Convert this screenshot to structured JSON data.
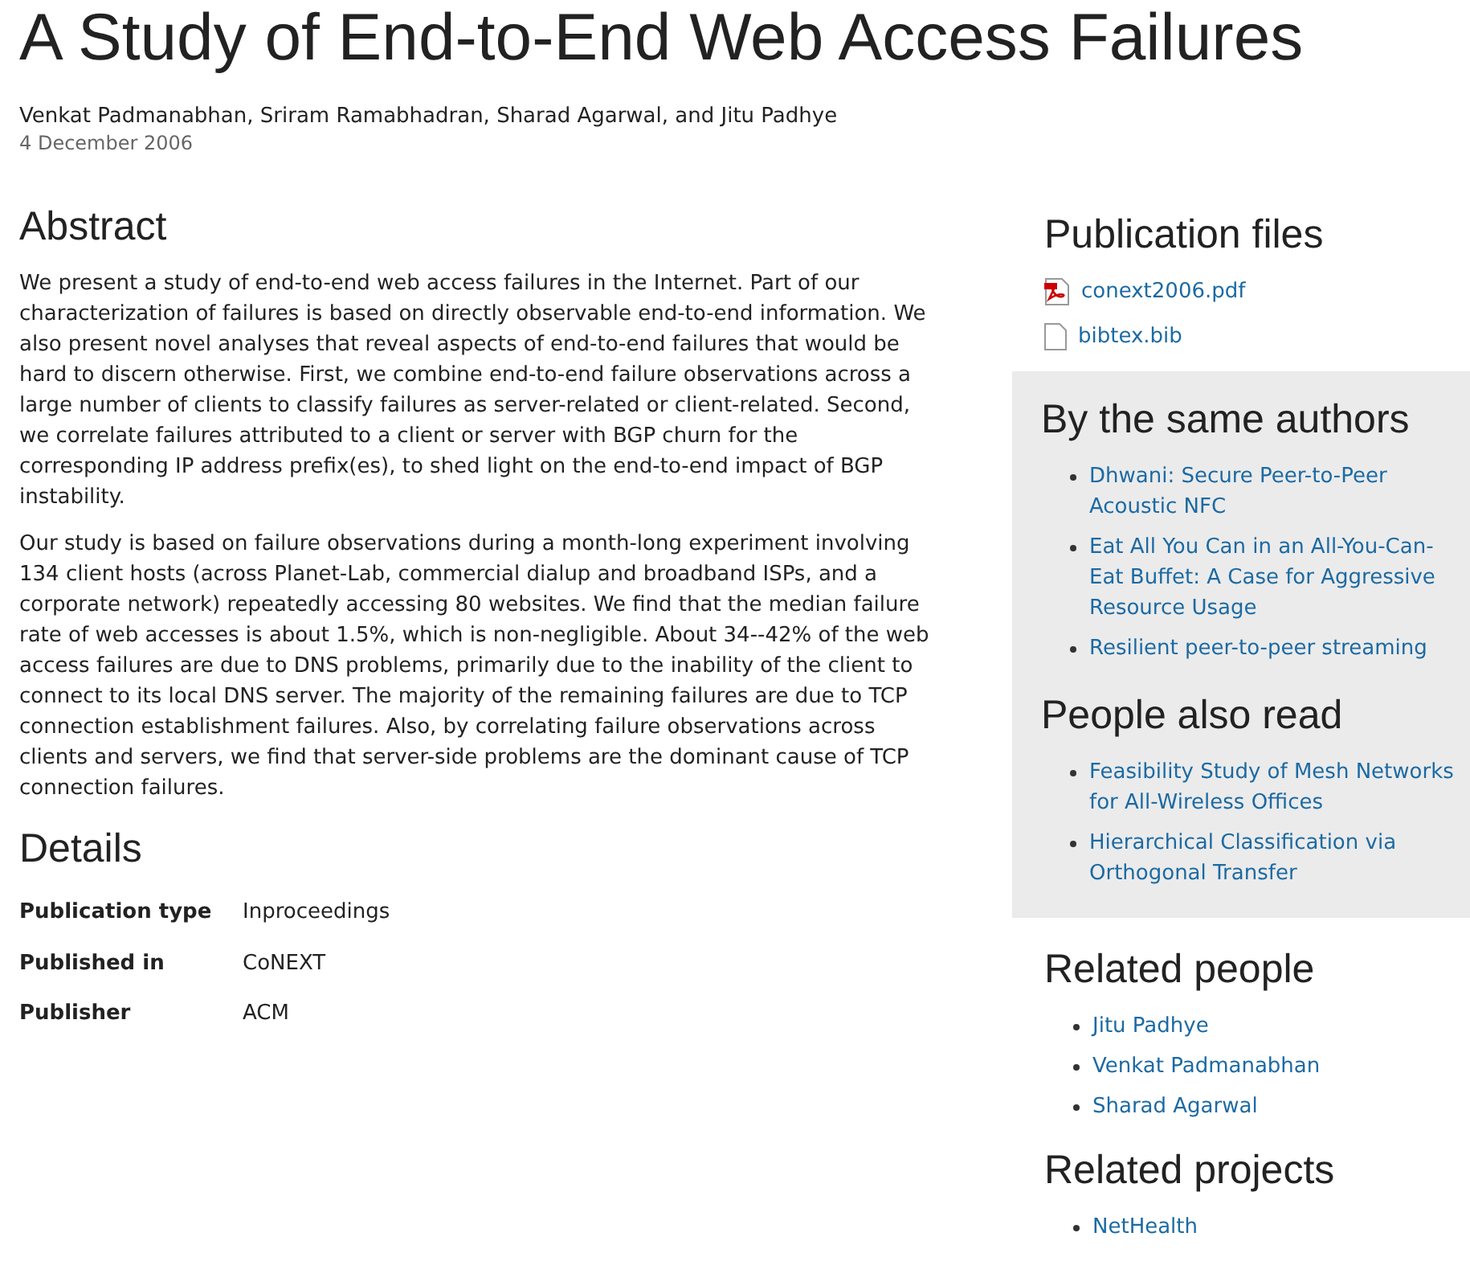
{
  "title": "A Study of End-to-End Web Access Failures",
  "authors": "Venkat Padmanabhan, Sriram Ramabhadran, Sharad Agarwal, and Jitu Padhye",
  "date": "4 December 2006",
  "abstract": {
    "heading": "Abstract",
    "paragraphs": [
      "We present a study of end-to-end web access failures in the Internet. Part of our characterization of failures is based on directly observable end-to-end information. We also present novel analyses that reveal aspects of end-to-end failures that would be hard to discern otherwise. First, we combine end-to-end failure observations across a large number of clients to classify failures as server-related or client-related. Second, we correlate failures attributed to a client or server with BGP churn for the corresponding IP address prefix(es), to shed light on the end-to-end impact of BGP instability.",
      "Our study is based on failure observations during a month-long experiment involving 134 client hosts (across Planet-Lab, commercial dialup and broadband ISPs, and a corporate network) repeatedly accessing 80 websites. We find that the median failure rate of web accesses is about 1.5%, which is non-negligible. About 34--42% of the web access failures are due to DNS problems, primarily due to the inability of the client to connect to its local DNS server. The majority of the remaining failures are due to TCP connection establishment failures. Also, by correlating failure observations across clients and servers, we find that server-side problems are the dominant cause of TCP connection failures."
    ]
  },
  "details": {
    "heading": "Details",
    "rows": [
      {
        "label": "Publication type",
        "value": "Inproceedings"
      },
      {
        "label": "Published in",
        "value": "CoNEXT"
      },
      {
        "label": "Publisher",
        "value": "ACM"
      }
    ]
  },
  "publication_files": {
    "heading": "Publication files",
    "files": [
      {
        "kind": "pdf",
        "name": "conext2006.pdf"
      },
      {
        "kind": "file",
        "name": "bibtex.bib"
      }
    ]
  },
  "same_authors": {
    "heading": "By the same authors",
    "items": [
      "Dhwani: Secure Peer-to-Peer Acoustic NFC",
      "Eat All You Can in an All-You-Can-Eat Buffet: A Case for Aggressive Resource Usage",
      "Resilient peer-to-peer streaming"
    ]
  },
  "also_read": {
    "heading": "People also read",
    "items": [
      "Feasibility Study of Mesh Networks for All-Wireless Offices",
      "Hierarchical Classification via Orthogonal Transfer"
    ]
  },
  "related_people": {
    "heading": "Related people",
    "items": [
      "Jitu Padhye",
      "Venkat Padmanabhan",
      "Sharad Agarwal"
    ]
  },
  "related_projects": {
    "heading": "Related projects",
    "items": [
      "NetHealth"
    ]
  }
}
